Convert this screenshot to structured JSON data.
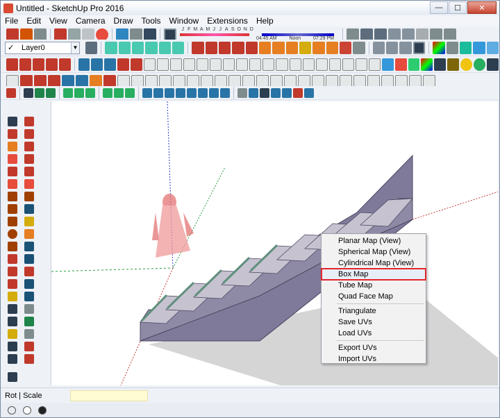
{
  "window": {
    "title": "Untitled - SketchUp Pro 2016"
  },
  "window_controls": {
    "minimize": "—",
    "maximize": "☐",
    "close": "✕"
  },
  "menu": [
    "File",
    "Edit",
    "View",
    "Camera",
    "Draw",
    "Tools",
    "Window",
    "Extensions",
    "Help"
  ],
  "layer": {
    "name": "Layer0",
    "check": "✓",
    "arrow": "▼"
  },
  "shadow_settings": {
    "months": [
      "J",
      "F",
      "M",
      "A",
      "M",
      "J",
      "J",
      "A",
      "S",
      "O",
      "N",
      "D"
    ],
    "times": [
      "04:45 AM",
      "Noon",
      "07:29 PM"
    ]
  },
  "context_menu": {
    "items": [
      "Planar Map (View)",
      "Spherical Map (View)",
      "Cylindrical Map (View)",
      "Box Map",
      "Tube Map",
      "Quad Face Map",
      "Triangulate",
      "Save UVs",
      "Load UVs",
      "Export UVs",
      "Import UVs"
    ],
    "highlighted": "Box Map"
  },
  "status": {
    "label": "Rot | Scale",
    "vcb_value": ""
  },
  "colors": {
    "stair_side": "#8e8aa6",
    "tread_top": "#b9b5c4",
    "tread_edge": "#5f8f7d",
    "accent_red": "#e3242b"
  }
}
